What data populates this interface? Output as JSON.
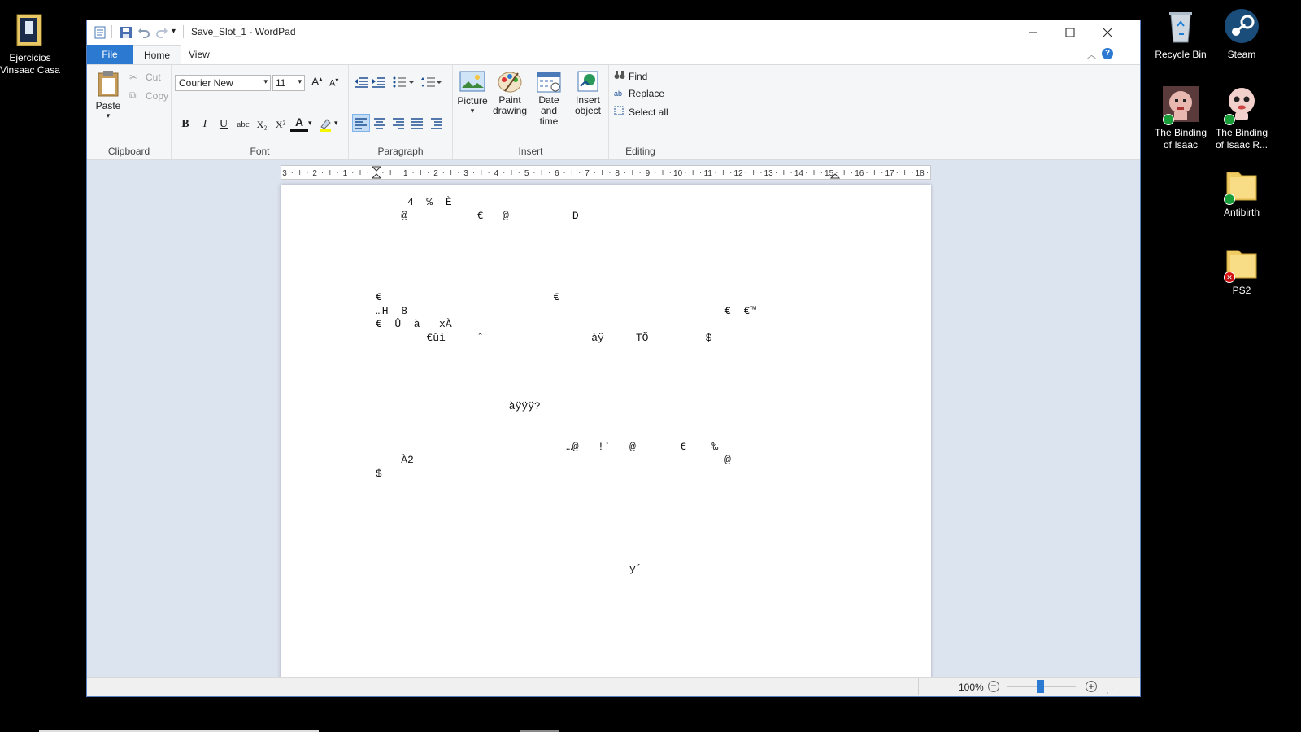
{
  "desktop": {
    "left_icons": [
      {
        "label": "Ejercicios\nVinsaac Casa"
      }
    ],
    "right_icons": [
      {
        "label": "Recycle Bin"
      },
      {
        "label": "Steam"
      },
      {
        "label": "The Binding\nof Isaac"
      },
      {
        "label": "The Binding\nof Isaac R..."
      },
      {
        "label": "Antibirth"
      },
      {
        "label": "PS2"
      }
    ]
  },
  "window": {
    "title": "Save_Slot_1 - WordPad",
    "tabs": [
      "File",
      "Home",
      "View"
    ],
    "active_tab": "Home",
    "accent": "#2b79d0"
  },
  "ribbon": {
    "clipboard": {
      "paste": "Paste",
      "cut": "Cut",
      "copy": "Copy",
      "label": "Clipboard"
    },
    "font": {
      "family": "Courier New",
      "size": "11",
      "label": "Font",
      "bold": "B",
      "italic": "I",
      "underline": "U",
      "strike": "abc",
      "subscript": "X₂",
      "superscript": "X²",
      "color_letter": "A"
    },
    "paragraph": {
      "label": "Paragraph"
    },
    "insert": {
      "picture": "Picture",
      "paint": "Paint\ndrawing",
      "datetime": "Date and\ntime",
      "object": "Insert\nobject",
      "label": "Insert"
    },
    "editing": {
      "find": "Find",
      "replace": "Replace",
      "select_all": "Select all",
      "label": "Editing"
    }
  },
  "ruler": {
    "ticks": [
      "3",
      "2",
      "1",
      "",
      "1",
      "2",
      "3",
      "4",
      "5",
      "6",
      "7",
      "8",
      "9",
      "10",
      "11",
      "12",
      "13",
      "14",
      "15",
      "16",
      "17",
      "18"
    ]
  },
  "document": {
    "lines": [
      {
        "text": "     4  %  È",
        "row": 0,
        "col": 0
      },
      {
        "text": "@           €   @          D",
        "row": 1,
        "col": 4
      },
      {
        "text": "              ",
        "row": 2,
        "col": 1
      },
      {
        "text": "",
        "row": 6,
        "col": 3
      },
      {
        "text": "€                           €",
        "row": 7,
        "col": 0
      },
      {
        "text": "…H  8                                                  €  €™",
        "row": 8,
        "col": 0
      },
      {
        "text": "€  Û  à   xÀ",
        "row": 9,
        "col": 0
      },
      {
        "text": "€ûì     ˆ                 àÿ     TÕ         $",
        "row": 10,
        "col": 8
      },
      {
        "text": "àÿÿÿ?",
        "row": 15,
        "col": 21
      },
      {
        "text": "…@   !`   @       €    ‰",
        "row": 18,
        "col": 30
      },
      {
        "text": "À2                                                 @",
        "row": 19,
        "col": 4
      },
      {
        "text": "$",
        "row": 20,
        "col": 0
      },
      {
        "text": "  ",
        "row": 24,
        "col": 9
      },
      {
        "text": "y´",
        "row": 27,
        "col": 40
      }
    ]
  },
  "status": {
    "zoom": "100%"
  }
}
